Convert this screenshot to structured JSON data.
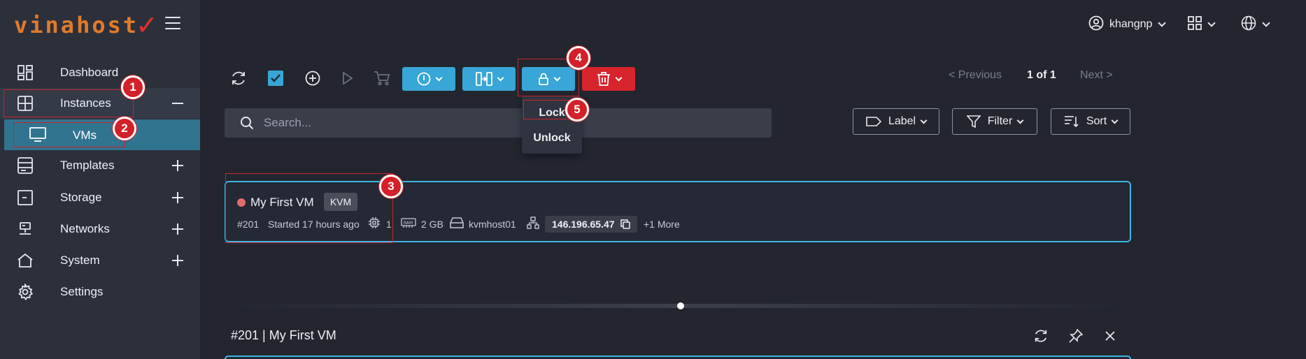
{
  "brand": {
    "logo_text": "vinahost",
    "logo_mark": "✓"
  },
  "topbar": {
    "username": "khangnp"
  },
  "sidebar": {
    "items": [
      {
        "label": "Dashboard",
        "icon": "dashboard-icon",
        "toggle": ""
      },
      {
        "label": "Instances",
        "icon": "instances-icon",
        "toggle": "minus"
      },
      {
        "label": "VMs",
        "icon": "monitor-icon",
        "toggle": ""
      },
      {
        "label": "Templates",
        "icon": "templates-icon",
        "toggle": "plus"
      },
      {
        "label": "Storage",
        "icon": "storage-icon",
        "toggle": "plus"
      },
      {
        "label": "Networks",
        "icon": "networks-icon",
        "toggle": "plus"
      },
      {
        "label": "System",
        "icon": "home-icon",
        "toggle": "plus"
      },
      {
        "label": "Settings",
        "icon": "gear-icon",
        "toggle": ""
      }
    ]
  },
  "pager": {
    "previous": "< Previous",
    "count": "1 of 1",
    "next": "Next >"
  },
  "lock_menu": {
    "options": [
      "Lock",
      "Unlock"
    ]
  },
  "search": {
    "placeholder": "Search..."
  },
  "filters": {
    "label": "Label",
    "filter": "Filter",
    "sort": "Sort"
  },
  "vm": {
    "name": "My First VM",
    "hypervisor": "KVM",
    "id": "#201",
    "started": "Started 17 hours ago",
    "cpu": "1",
    "ram": "2 GB",
    "host": "kvmhost01",
    "ip": "146.196.65.47",
    "more": "+1 More",
    "status_color": "#e06b6b"
  },
  "detail": {
    "title": "#201 | My First VM"
  },
  "annotations": [
    "1",
    "2",
    "3",
    "4",
    "5"
  ],
  "colors": {
    "accent": "#38a6d6",
    "danger": "#d8242c",
    "active_sub": "#31748f",
    "annotation": "#c8232c"
  }
}
